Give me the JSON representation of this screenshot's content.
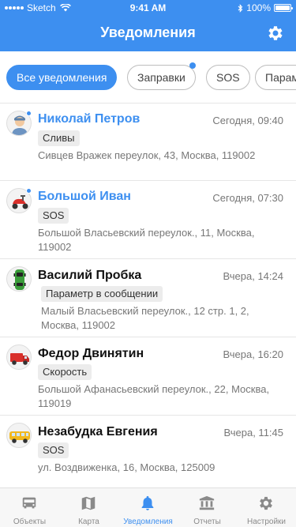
{
  "status_bar": {
    "carrier": "Sketch",
    "time": "9:41 AM",
    "battery": "100%"
  },
  "header": {
    "title": "Уведомления",
    "settings_icon": "gear-icon"
  },
  "filters": [
    {
      "label": "Все уведомления",
      "active": true,
      "dot": false
    },
    {
      "label": "Заправки",
      "active": false,
      "dot": true
    },
    {
      "label": "SOS",
      "active": false,
      "dot": false
    },
    {
      "label": "Парам",
      "active": false,
      "dot": false
    }
  ],
  "notifications": [
    {
      "name": "Николай Петров",
      "time": "Сегодня, 09:40",
      "tag": "Сливы",
      "address": "Сивцев Вражек переулок, 43, Москва, 119002",
      "unread": true,
      "avatar": "driver-icon"
    },
    {
      "name": "Большой Иван",
      "time": "Сегодня, 07:30",
      "tag": "SOS",
      "address": "Большой Власьевский переулок., 11, Москва, 119002",
      "unread": true,
      "avatar": "scooter-icon"
    },
    {
      "name": "Василий Пробка",
      "time": "Вчера, 14:24",
      "tag": "Параметр в сообщении",
      "address": "Малый Власьевский переулок., 12 стр. 1, 2, Москва, 119002",
      "unread": false,
      "avatar": "green-car-icon"
    },
    {
      "name": "Федор Двинятин",
      "time": "Вчера, 16:20",
      "tag": "Скорость",
      "address": "Большой Афанасьевский переулок., 22, Москва, 119019",
      "unread": false,
      "avatar": "red-truck-icon"
    },
    {
      "name": "Незабудка Евгения",
      "time": "Вчера, 11:45",
      "tag": "SOS",
      "address": "ул. Воздвиженка, 16, Москва, 125009",
      "unread": false,
      "avatar": "school-bus-icon"
    }
  ],
  "tabs": [
    {
      "label": "Объекты",
      "icon": "bus-icon",
      "active": false
    },
    {
      "label": "Карта",
      "icon": "map-icon",
      "active": false
    },
    {
      "label": "Уведомления",
      "icon": "bell-icon",
      "active": true
    },
    {
      "label": "Отчеты",
      "icon": "reports-icon",
      "active": false
    },
    {
      "label": "Настройки",
      "icon": "gear-icon",
      "active": false
    }
  ],
  "colors": {
    "accent": "#3d8ff0",
    "header_bg": "#3d8ff0",
    "tabbar_bg": "#f7f7f7",
    "inactive_tab": "#8a8a8a"
  }
}
